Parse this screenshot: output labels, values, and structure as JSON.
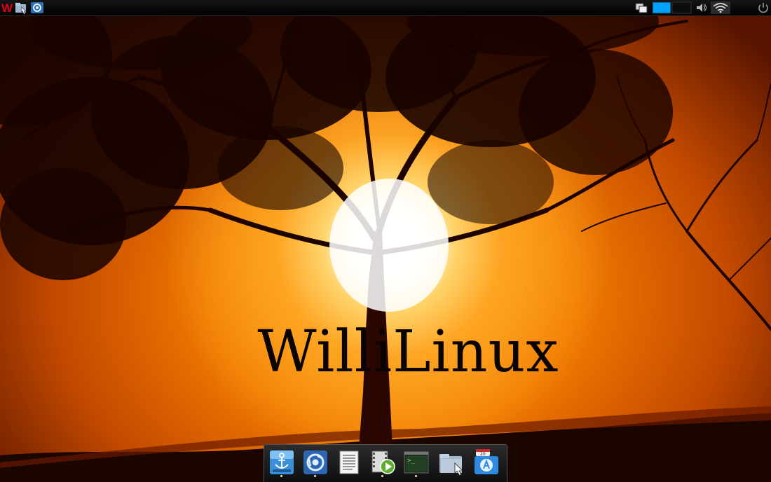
{
  "desktop": {
    "wallpaper_text": "WilliLinux"
  },
  "top_panel": {
    "left_icons": [
      "willilinux-menu-icon",
      "file-manager-icon",
      "browser-icon"
    ],
    "right_icons": [
      "window-list-icon",
      "workspace-switcher",
      "volume-icon",
      "wifi-icon",
      "power-icon"
    ],
    "clock_text": "",
    "colors": {
      "workspace_active": "#00a2ff",
      "panel_bg": "#000000"
    }
  },
  "dock": {
    "items": [
      {
        "name": "anchor-app-icon"
      },
      {
        "name": "chromium-icon"
      },
      {
        "name": "text-editor-icon"
      },
      {
        "name": "media-player-icon"
      },
      {
        "name": "terminal-icon"
      },
      {
        "name": "file-manager-icon"
      },
      {
        "name": "software-store-icon"
      }
    ]
  }
}
